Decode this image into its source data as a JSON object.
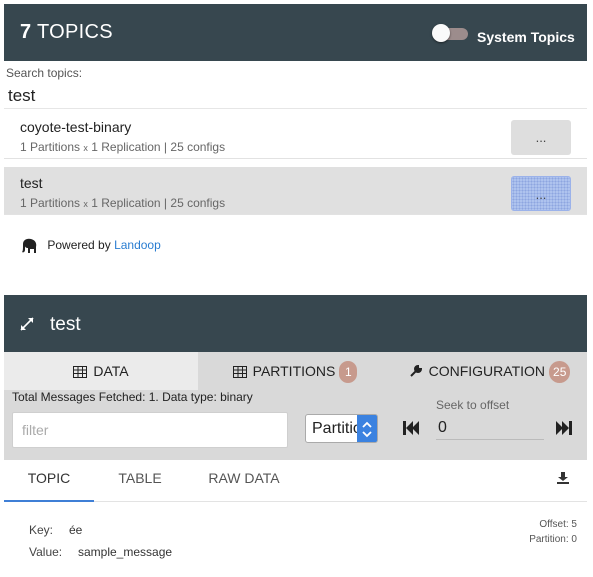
{
  "topics_panel": {
    "count": "7",
    "title": "TOPICS",
    "system_topics_label": "System Topics",
    "search_label": "Search topics:",
    "search_value": "test",
    "topics": [
      {
        "name": "coyote-test-binary",
        "partitions": "1 Partitions",
        "replication": "1 Replication",
        "configs": "25 configs",
        "button": "...",
        "selected": false
      },
      {
        "name": "test",
        "partitions": "1 Partitions",
        "replication": "1 Replication",
        "configs": "25 configs",
        "button": "...",
        "selected": true
      }
    ],
    "powered_by": "Powered by",
    "powered_link": "Landoop"
  },
  "detail": {
    "title": "test",
    "tabs": [
      {
        "label": "DATA",
        "icon": "table-icon"
      },
      {
        "label": "PARTITIONS",
        "icon": "table-icon",
        "badge": "1"
      },
      {
        "label": "CONFIGURATION",
        "icon": "wrench-icon",
        "badge": "25"
      }
    ],
    "fetched_text": "Total Messages Fetched: 1. Data type: binary",
    "filter_placeholder": "filter",
    "partition_select": "Partition",
    "seek_label": "Seek to offset",
    "seek_value": "0",
    "subtabs": [
      "TOPIC",
      "TABLE",
      "RAW DATA"
    ],
    "message": {
      "key_label": "Key:",
      "key_value": "ée",
      "value_label": "Value:",
      "value_value": "sample_message",
      "offset": "Offset: 5",
      "partition": "Partition: 0"
    }
  },
  "colors": {
    "header_bg": "#37474f",
    "accent_blue": "#3f7fd6",
    "badge": "#c79a8d",
    "link": "#2a7dd1"
  }
}
